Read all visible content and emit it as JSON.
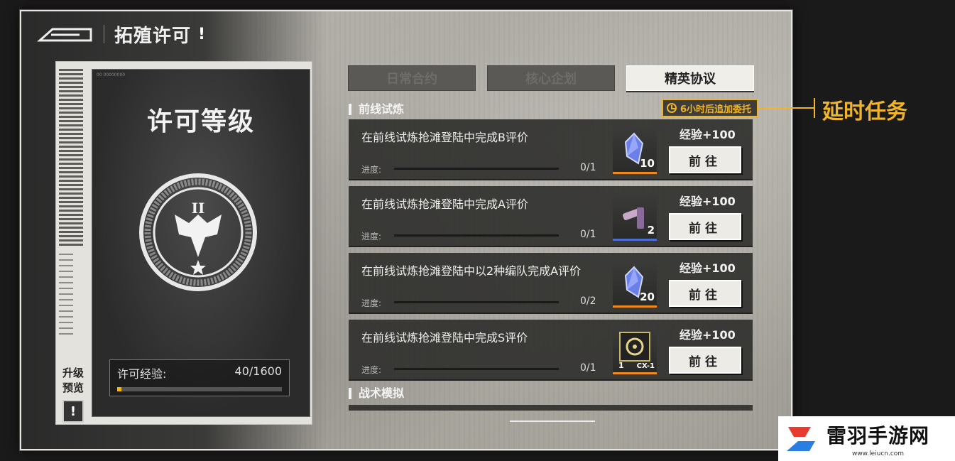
{
  "header": {
    "title": "拓殖许可",
    "info_mark": "!"
  },
  "card": {
    "title": "许可等级",
    "tiny_text": "00 00000000",
    "emblem_rank": "II",
    "exp_label": "许可经验:",
    "exp_value": "40/1600",
    "exp_fraction": 0.025,
    "upgrade_label": "升级预览",
    "upgrade_icon": "!"
  },
  "tabs": [
    {
      "label": "日常合约",
      "active": false
    },
    {
      "label": "核心企划",
      "active": false
    },
    {
      "label": "精英协议",
      "active": true
    }
  ],
  "sections": {
    "frontline": "前线试炼",
    "tactical": "战术模拟"
  },
  "timer": {
    "icon": "clock-icon",
    "text": "6小时后追加委托"
  },
  "tasks": [
    {
      "name": "在前线试炼抢滩登陆中完成B评价",
      "progress_label": "进度:",
      "count": "0/1",
      "reward_icon": "crystal-icon",
      "reward_qty": "10",
      "rarity_color": "#f08a1c",
      "exp": "经验+100",
      "go": "前往"
    },
    {
      "name": "在前线试炼抢滩登陆中完成A评价",
      "progress_label": "进度:",
      "count": "0/1",
      "reward_icon": "ammo-icon",
      "reward_qty": "2",
      "rarity_color": "#4a6fd8",
      "exp": "经验+100",
      "go": "前往"
    },
    {
      "name": "在前线试炼抢滩登陆中以2种编队完成A评价",
      "progress_label": "进度:",
      "count": "0/2",
      "reward_icon": "crystal-icon",
      "reward_qty": "20",
      "rarity_color": "#f08a1c",
      "exp": "经验+100",
      "go": "前往"
    },
    {
      "name": "在前线试炼抢滩登陆中完成S评价",
      "progress_label": "进度:",
      "count": "0/1",
      "reward_icon": "chip-icon",
      "reward_qty": "1",
      "reward_code": "CX-1",
      "rarity_color": "#f08a1c",
      "exp": "经验+100",
      "go": "前往"
    }
  ],
  "callout": "延时任务",
  "watermark": {
    "title": "雷羽手游网",
    "url": "www.leiucn.com"
  },
  "colors": {
    "accent": "#f0b429",
    "exp_fill": "#f5b800"
  }
}
